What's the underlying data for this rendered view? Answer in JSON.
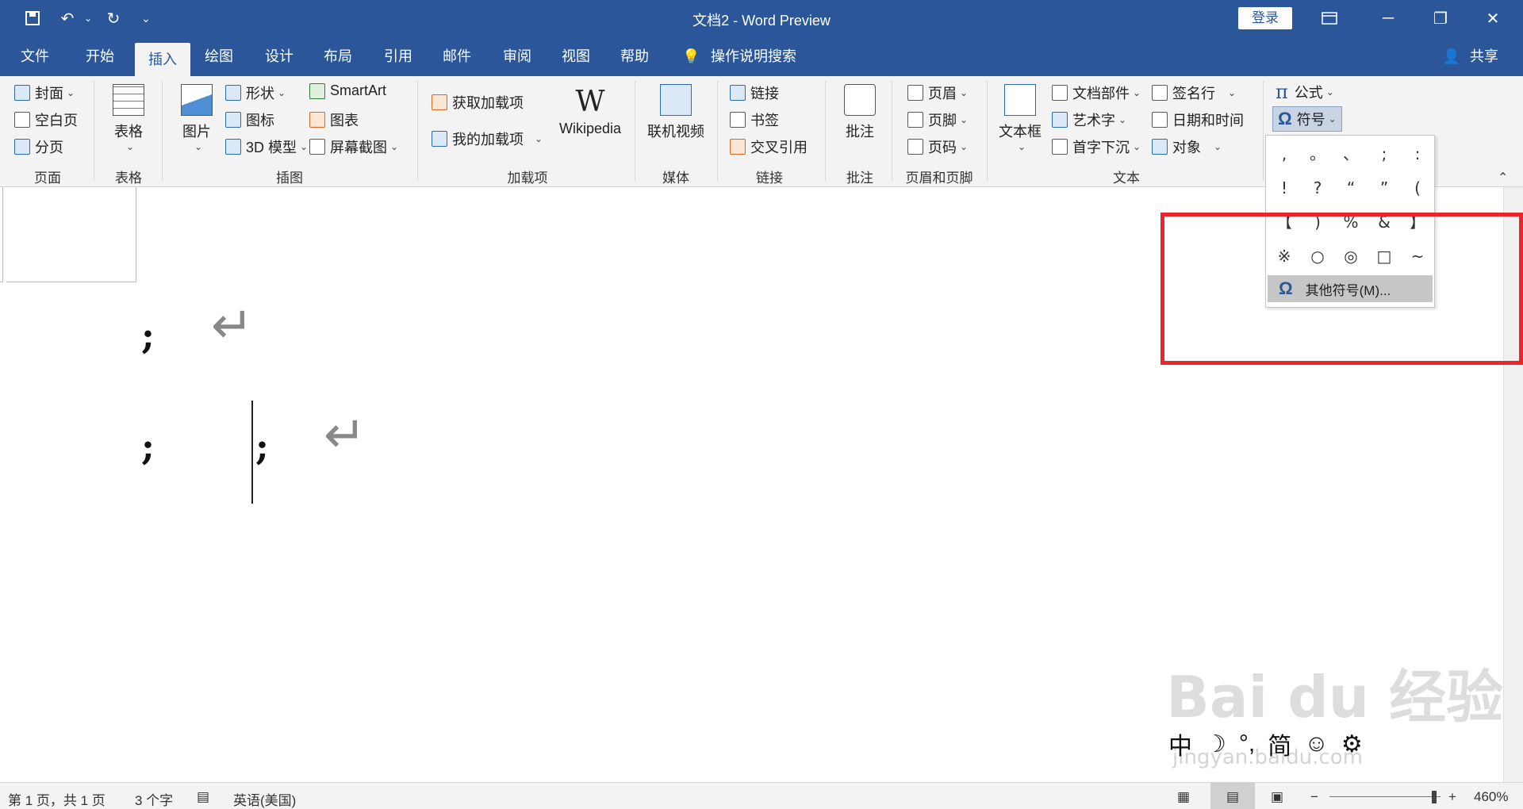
{
  "window": {
    "title": "文档2  -  Word Preview",
    "login_label": "登录",
    "share_label": "共享"
  },
  "tabs": [
    {
      "label": "文件"
    },
    {
      "label": "开始"
    },
    {
      "label": "插入"
    },
    {
      "label": "绘图"
    },
    {
      "label": "设计"
    },
    {
      "label": "布局"
    },
    {
      "label": "引用"
    },
    {
      "label": "邮件"
    },
    {
      "label": "审阅"
    },
    {
      "label": "视图"
    },
    {
      "label": "帮助"
    },
    {
      "label": "操作说明搜索"
    }
  ],
  "ribbon": {
    "pages": {
      "cover": "封面",
      "blank": "空白页",
      "break": "分页",
      "group": "页面"
    },
    "table": {
      "label": "表格",
      "group": "表格"
    },
    "illustrations": {
      "picture": "图片",
      "shapes": "形状",
      "icons": "图标",
      "model3d": "3D 模型",
      "smartart": "SmartArt",
      "chart": "图表",
      "screenshot": "屏幕截图",
      "group": "插图"
    },
    "addins": {
      "get": "获取加载项",
      "mine": "我的加载项",
      "wikipedia": "Wikipedia",
      "wikipedia_logo": "W",
      "group": "加载项"
    },
    "media": {
      "video": "联机视频",
      "group": "媒体"
    },
    "links": {
      "link": "链接",
      "bookmark": "书签",
      "crossref": "交叉引用",
      "group": "链接"
    },
    "comments": {
      "comment": "批注",
      "group": "批注"
    },
    "header_footer": {
      "header": "页眉",
      "footer": "页脚",
      "page_number": "页码",
      "group": "页眉和页脚"
    },
    "text": {
      "textbox": "文本框",
      "quickparts": "文档部件",
      "wordart": "艺术字",
      "dropcap": "首字下沉",
      "signature": "签名行",
      "datetime": "日期和时间",
      "object": "对象",
      "group": "文本"
    },
    "symbols": {
      "equation": "公式",
      "symbol": "符号",
      "pi": "π",
      "omega": "Ω"
    }
  },
  "symbol_panel": {
    "symbols": [
      ",",
      "。",
      "、",
      ";",
      ":",
      "!",
      "?",
      "“",
      "”",
      "(",
      "【",
      ")",
      "%",
      "&",
      "】",
      "※",
      "○",
      "◎",
      "□",
      "~"
    ],
    "more_label": "其他符号(M)..."
  },
  "document": {
    "chars": [
      ";",
      ";",
      ";"
    ],
    "para_mark": "↵"
  },
  "ime": [
    "中",
    "☽",
    "°,",
    "简",
    "☺",
    "⚙"
  ],
  "watermark": {
    "main": "Bai du 经验",
    "sub": "jingyan.baidu.com"
  },
  "status": {
    "page": "第 1 页，共 1 页",
    "words": "3 个字",
    "language": "英语(美国)",
    "zoom": "460%",
    "zoom_level_fraction": 0.94
  },
  "colors": {
    "accent": "#2b579a",
    "highlight_box": "#e8262b"
  }
}
